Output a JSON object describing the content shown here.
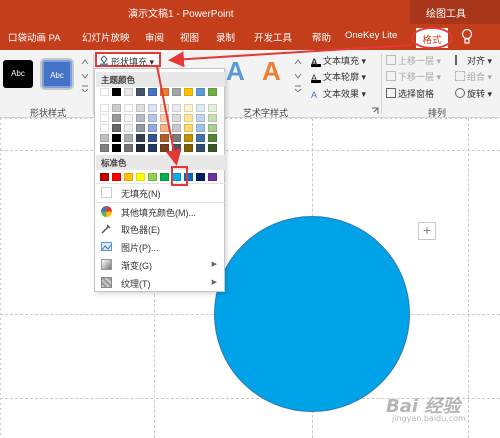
{
  "window": {
    "title": "演示文稿1  -  PowerPoint",
    "context_tab_group": "绘图工具"
  },
  "tabs": [
    {
      "label": "口袋动画 PA"
    },
    {
      "label": "幻灯片放映"
    },
    {
      "label": "审阅"
    },
    {
      "label": "视图"
    },
    {
      "label": "录制"
    },
    {
      "label": "开发工具"
    },
    {
      "label": "帮助"
    },
    {
      "label": "OneKey Lite"
    }
  ],
  "active_tab": "格式",
  "ribbon": {
    "shape_styles": {
      "style1": "Abc",
      "style2": "Abc",
      "group_label": "形状样式"
    },
    "shape_fill_label": "形状填充 ▾",
    "art_text": {
      "group_label": "艺术字样式",
      "text_fill": "文本填充 ▾",
      "text_outline": "文本轮廓 ▾",
      "text_effect": "文本效果 ▾"
    },
    "arrange": {
      "group_label": "排列",
      "bring_forward": "上移一层 ▾",
      "send_backward": "下移一层 ▾",
      "selection_pane": "选择窗格",
      "align": "对齐 ▾",
      "group": "组合 ▾",
      "rotate": "旋转 ▾"
    }
  },
  "dropdown": {
    "theme_colors_header": "主题颜色",
    "standard_colors_header": "标准色",
    "no_fill": "无填充(N)",
    "more_colors": "其他填充颜色(M)...",
    "eyedropper": "取色器(E)",
    "picture": "图片(P)...",
    "gradient": "渐变(G)",
    "texture": "纹理(T)"
  },
  "colors": {
    "theme_base": [
      "#ffffff",
      "#000000",
      "#e7e6e6",
      "#44546a",
      "#4472c4",
      "#ed7d31",
      "#a5a5a5",
      "#ffc000",
      "#5b9bd5",
      "#70ad47"
    ],
    "standard": [
      "#c00000",
      "#ff0000",
      "#ffc000",
      "#ffff00",
      "#92d050",
      "#00b050",
      "#00b0f0",
      "#0070c0",
      "#002060",
      "#7030a0"
    ],
    "shape_fill": "#00a3e8",
    "highlight": "#e53935",
    "ribbon_accent": "#c43e1c"
  },
  "slide": {
    "plus_handle": "+"
  },
  "watermark": {
    "main": "Bai 经验",
    "sub": "jingyan.baidu.com"
  }
}
